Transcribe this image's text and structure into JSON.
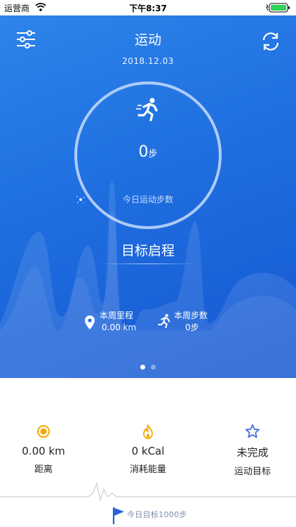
{
  "status_bar": {
    "carrier": "运营商",
    "time": "下午8:37"
  },
  "header": {
    "title": "运动",
    "date": "2018.12.03",
    "menu_icon": "filter-sliders-icon",
    "sync_icon": "refresh-sync-icon"
  },
  "today": {
    "steps_value": "0",
    "steps_unit": "步",
    "label": "今日运动步数"
  },
  "goal_section": {
    "title": "目标启程"
  },
  "weekly": {
    "distance_label": "本周里程",
    "distance_value": "0.00 km",
    "steps_label": "本周步数",
    "steps_value": "0步"
  },
  "pager": {
    "pages": 2,
    "active": 0
  },
  "stats": {
    "distance": {
      "value": "0.00 km",
      "label": "距离",
      "icon": "clock-dot-icon"
    },
    "calories": {
      "value": "0 kCal",
      "label": "消耗能量",
      "icon": "flame-icon"
    },
    "goal": {
      "value": "未完成",
      "label": "运动目标",
      "icon": "star-icon"
    }
  },
  "footer": {
    "daily_goal": "今日目标1000步"
  },
  "colors": {
    "hero_blue": "#1f6fe0",
    "accent_orange": "#f5a800",
    "star_blue": "#4a6fd8",
    "battery_green": "#2fd158"
  }
}
